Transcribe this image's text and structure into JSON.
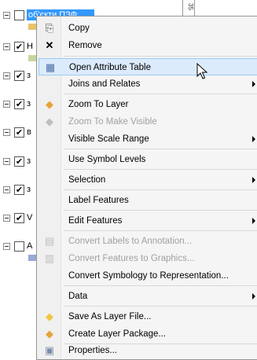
{
  "toc": {
    "selected_layer_label": "об'єкти ПЗФ",
    "side_text": "35",
    "rows": [
      {
        "check": "",
        "patch": "#e8c46a"
      },
      {
        "check": "✔",
        "label": "Н",
        "patch": "#c8d6a0"
      },
      {
        "check": "✔",
        "label": "з",
        "patch": ""
      },
      {
        "check": "✔",
        "label": "з",
        "patch": ""
      },
      {
        "check": "✔",
        "label": "в",
        "patch": ""
      },
      {
        "check": "✔",
        "label": "з",
        "patch": ""
      },
      {
        "check": "✔",
        "label": "з",
        "patch": ""
      },
      {
        "check": "✔",
        "label": "V",
        "patch": ""
      },
      {
        "check": "",
        "label": "А",
        "patch": "#9aa8d8"
      }
    ]
  },
  "menu": {
    "items": [
      {
        "label": "Copy",
        "icon": "copy-icon",
        "glyph": "⎘",
        "disabled": false,
        "submenu": false
      },
      {
        "label": "Remove",
        "icon": "remove-icon",
        "glyph": "✕",
        "disabled": false,
        "submenu": false
      },
      {
        "label": "Open Attribute Table",
        "icon": "table-icon",
        "glyph": "▦",
        "disabled": false,
        "submenu": false,
        "highlight": true
      },
      {
        "label": "Joins and Relates",
        "icon": "",
        "glyph": "",
        "disabled": false,
        "submenu": true
      },
      {
        "label": "Zoom To Layer",
        "icon": "zoom-to-layer-icon",
        "glyph": "◆",
        "disabled": false,
        "submenu": false
      },
      {
        "label": "Zoom To Make Visible",
        "icon": "zoom-visible-icon",
        "glyph": "◆",
        "disabled": true,
        "submenu": false
      },
      {
        "label": "Visible Scale Range",
        "icon": "",
        "glyph": "",
        "disabled": false,
        "submenu": true
      },
      {
        "label": "Use Symbol Levels",
        "icon": "",
        "glyph": "",
        "disabled": false,
        "submenu": false
      },
      {
        "label": "Selection",
        "icon": "",
        "glyph": "",
        "disabled": false,
        "submenu": true
      },
      {
        "label": "Label Features",
        "icon": "",
        "glyph": "",
        "disabled": false,
        "submenu": false
      },
      {
        "label": "Edit Features",
        "icon": "",
        "glyph": "",
        "disabled": false,
        "submenu": true
      },
      {
        "label": "Convert Labels to Annotation...",
        "icon": "convert-labels-icon",
        "glyph": "▤",
        "disabled": true,
        "submenu": false
      },
      {
        "label": "Convert Features to Graphics...",
        "icon": "convert-features-icon",
        "glyph": "▥",
        "disabled": true,
        "submenu": false
      },
      {
        "label": "Convert Symbology to Representation...",
        "icon": "",
        "glyph": "",
        "disabled": false,
        "submenu": false
      },
      {
        "label": "Data",
        "icon": "",
        "glyph": "",
        "disabled": false,
        "submenu": true
      },
      {
        "label": "Save As Layer File...",
        "icon": "layer-file-icon",
        "glyph": "◆",
        "disabled": false,
        "submenu": false
      },
      {
        "label": "Create Layer Package...",
        "icon": "layer-package-icon",
        "glyph": "◆",
        "disabled": false,
        "submenu": false
      },
      {
        "label": "Properties...",
        "icon": "properties-icon",
        "glyph": "▣",
        "disabled": false,
        "submenu": false
      }
    ]
  },
  "colors": {
    "highlight_bg": "#dcebfc",
    "highlight_border": "#9ccaf4",
    "selected_layer_bg": "#3399ff",
    "zoom_icon": "#e8a23a",
    "layer_icon": "#f2c440"
  }
}
